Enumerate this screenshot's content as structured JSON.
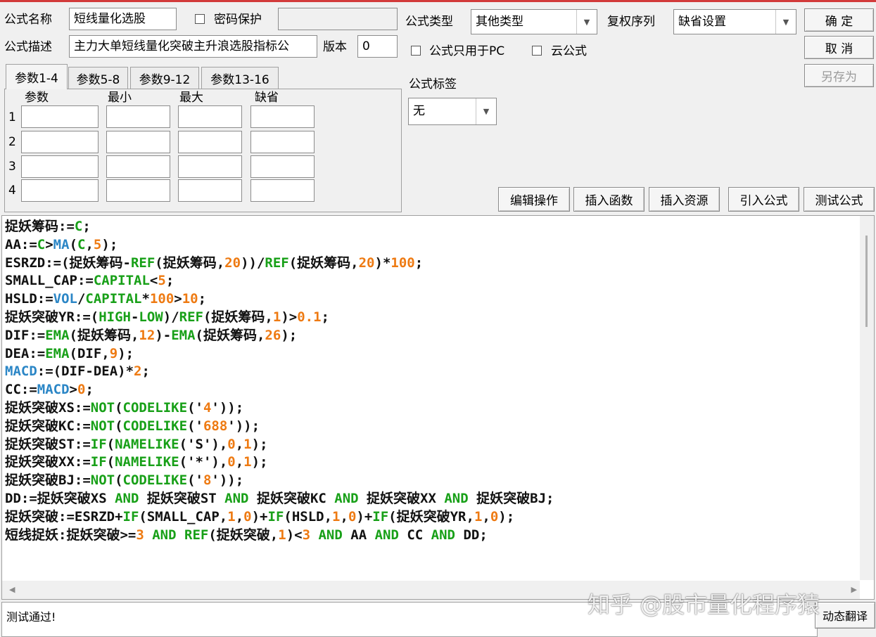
{
  "formula": {
    "name_label": "公式名称",
    "name_value": "短线量化选股",
    "password_label": "密码保护",
    "desc_label": "公式描述",
    "desc_value": "主力大单短线量化突破主升浪选股指标公",
    "version_label": "版本",
    "version_value": "0",
    "type_label": "公式类型",
    "type_value": "其他类型",
    "rights_label": "复权序列",
    "rights_value": "缺省设置",
    "pc_only_label": "公式只用于PC",
    "cloud_label": "云公式",
    "tag_label": "公式标签",
    "tag_value": "无"
  },
  "buttons": {
    "ok": "确  定",
    "cancel": "取  消",
    "save_as": "另存为",
    "edit_ops": "编辑操作",
    "insert_func": "插入函数",
    "insert_res": "插入资源",
    "import_formula": "引入公式",
    "test_formula": "测试公式",
    "dynamic_translate": "动态翻译"
  },
  "tabs": [
    "参数1-4",
    "参数5-8",
    "参数9-12",
    "参数13-16"
  ],
  "params": {
    "headers": [
      "参数",
      "最小",
      "最大",
      "缺省"
    ],
    "rows": [
      "1",
      "2",
      "3",
      "4"
    ]
  },
  "code_lines": [
    [
      [
        "捉妖筹码:=",
        ""
      ],
      [
        "C",
        "fn"
      ],
      [
        ";",
        ""
      ]
    ],
    [
      [
        "AA:=",
        ""
      ],
      [
        "C",
        "fn"
      ],
      [
        ">",
        ""
      ],
      [
        "MA",
        "blu"
      ],
      [
        "(",
        ""
      ],
      [
        "C",
        "fn"
      ],
      [
        ",",
        ""
      ],
      [
        "5",
        "num"
      ],
      [
        ");",
        ""
      ]
    ],
    [
      [
        "ESRZD:=(捉妖筹码-",
        ""
      ],
      [
        "REF",
        "fn"
      ],
      [
        "(捉妖筹码,",
        ""
      ],
      [
        "20",
        "num"
      ],
      [
        "))/",
        ""
      ],
      [
        "REF",
        "fn"
      ],
      [
        "(捉妖筹码,",
        ""
      ],
      [
        "20",
        "num"
      ],
      [
        ")*",
        ""
      ],
      [
        "100",
        "num"
      ],
      [
        ";",
        ""
      ]
    ],
    [
      [
        "SMALL_CAP:=",
        ""
      ],
      [
        "CAPITAL",
        "fn"
      ],
      [
        "<",
        ""
      ],
      [
        "5",
        "num"
      ],
      [
        ";",
        ""
      ]
    ],
    [
      [
        "HSLD:=",
        ""
      ],
      [
        "VOL",
        "blu"
      ],
      [
        "/",
        ""
      ],
      [
        "CAPITAL",
        "fn"
      ],
      [
        "*",
        ""
      ],
      [
        "100",
        "num"
      ],
      [
        ">",
        ""
      ],
      [
        "10",
        "num"
      ],
      [
        ";",
        ""
      ]
    ],
    [
      [
        "捉妖突破YR:=(",
        ""
      ],
      [
        "HIGH",
        "fn"
      ],
      [
        "-",
        ""
      ],
      [
        "LOW",
        "fn"
      ],
      [
        ")/",
        ""
      ],
      [
        "REF",
        "fn"
      ],
      [
        "(捉妖筹码,",
        ""
      ],
      [
        "1",
        "num"
      ],
      [
        ")>",
        ""
      ],
      [
        "0.1",
        "num"
      ],
      [
        ";",
        ""
      ]
    ],
    [
      [
        "DIF:=",
        ""
      ],
      [
        "EMA",
        "fn"
      ],
      [
        "(捉妖筹码,",
        ""
      ],
      [
        "12",
        "num"
      ],
      [
        ")-",
        ""
      ],
      [
        "EMA",
        "fn"
      ],
      [
        "(捉妖筹码,",
        ""
      ],
      [
        "26",
        "num"
      ],
      [
        ");",
        ""
      ]
    ],
    [
      [
        "DEA:=",
        ""
      ],
      [
        "EMA",
        "fn"
      ],
      [
        "(DIF,",
        ""
      ],
      [
        "9",
        "num"
      ],
      [
        ");",
        ""
      ]
    ],
    [
      [
        "MACD",
        "blu"
      ],
      [
        ":=(DIF-DEA)*",
        ""
      ],
      [
        "2",
        "num"
      ],
      [
        ";",
        ""
      ]
    ],
    [
      [
        "CC:=",
        ""
      ],
      [
        "MACD",
        "blu"
      ],
      [
        ">",
        ""
      ],
      [
        "0",
        "num"
      ],
      [
        ";",
        ""
      ]
    ],
    [
      [
        "捉妖突破XS:=",
        ""
      ],
      [
        "NOT",
        "fn"
      ],
      [
        "(",
        ""
      ],
      [
        "CODELIKE",
        "fn"
      ],
      [
        "('",
        ""
      ],
      [
        "4",
        "num"
      ],
      [
        "'));",
        ""
      ]
    ],
    [
      [
        "捉妖突破KC:=",
        ""
      ],
      [
        "NOT",
        "fn"
      ],
      [
        "(",
        ""
      ],
      [
        "CODELIKE",
        "fn"
      ],
      [
        "('",
        ""
      ],
      [
        "688",
        "num"
      ],
      [
        "'));",
        ""
      ]
    ],
    [
      [
        "捉妖突破ST:=",
        ""
      ],
      [
        "IF",
        "fn"
      ],
      [
        "(",
        ""
      ],
      [
        "NAMELIKE",
        "fn"
      ],
      [
        "('S'),",
        ""
      ],
      [
        "0",
        "num"
      ],
      [
        ",",
        ""
      ],
      [
        "1",
        "num"
      ],
      [
        ");",
        ""
      ]
    ],
    [
      [
        "捉妖突破XX:=",
        ""
      ],
      [
        "IF",
        "fn"
      ],
      [
        "(",
        ""
      ],
      [
        "NAMELIKE",
        "fn"
      ],
      [
        "('*'),",
        ""
      ],
      [
        "0",
        "num"
      ],
      [
        ",",
        ""
      ],
      [
        "1",
        "num"
      ],
      [
        ");",
        ""
      ]
    ],
    [
      [
        "捉妖突破BJ:=",
        ""
      ],
      [
        "NOT",
        "fn"
      ],
      [
        "(",
        ""
      ],
      [
        "CODELIKE",
        "fn"
      ],
      [
        "('",
        ""
      ],
      [
        "8",
        "num"
      ],
      [
        "'));",
        ""
      ]
    ],
    [
      [
        "DD:=捉妖突破XS ",
        ""
      ],
      [
        "AND",
        "fn"
      ],
      [
        " 捉妖突破ST ",
        ""
      ],
      [
        "AND",
        "fn"
      ],
      [
        " 捉妖突破KC ",
        ""
      ],
      [
        "AND",
        "fn"
      ],
      [
        " 捉妖突破XX ",
        ""
      ],
      [
        "AND",
        "fn"
      ],
      [
        " 捉妖突破BJ;",
        ""
      ]
    ],
    [
      [
        "捉妖突破:=ESRZD+",
        ""
      ],
      [
        "IF",
        "fn"
      ],
      [
        "(SMALL_CAP,",
        ""
      ],
      [
        "1",
        "num"
      ],
      [
        ",",
        ""
      ],
      [
        "0",
        "num"
      ],
      [
        ")+",
        ""
      ],
      [
        "IF",
        "fn"
      ],
      [
        "(HSLD,",
        ""
      ],
      [
        "1",
        "num"
      ],
      [
        ",",
        ""
      ],
      [
        "0",
        "num"
      ],
      [
        ")+",
        ""
      ],
      [
        "IF",
        "fn"
      ],
      [
        "(捉妖突破YR,",
        ""
      ],
      [
        "1",
        "num"
      ],
      [
        ",",
        ""
      ],
      [
        "0",
        "num"
      ],
      [
        ");",
        ""
      ]
    ],
    [
      [
        "短线捉妖:捉妖突破>=",
        ""
      ],
      [
        "3",
        "num"
      ],
      [
        " ",
        ""
      ],
      [
        "AND",
        "fn"
      ],
      [
        " ",
        ""
      ],
      [
        "REF",
        "fn"
      ],
      [
        "(捉妖突破,",
        ""
      ],
      [
        "1",
        "num"
      ],
      [
        ")<",
        ""
      ],
      [
        "3",
        "num"
      ],
      [
        " ",
        ""
      ],
      [
        "AND",
        "fn"
      ],
      [
        " AA ",
        ""
      ],
      [
        "AND",
        "fn"
      ],
      [
        " CC ",
        ""
      ],
      [
        "AND",
        "fn"
      ],
      [
        " DD;",
        ""
      ]
    ]
  ],
  "status_text": "测试通过!",
  "watermark": "知乎 @股市量化程序猿",
  "colors": {
    "function": "#18a018",
    "number": "#ee7a12",
    "keyword_blue": "#2b86c6",
    "top_bar": "#d23a3a"
  }
}
